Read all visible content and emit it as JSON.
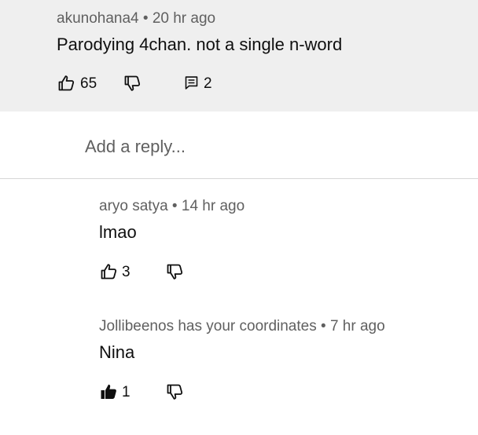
{
  "parent_comment": {
    "author": "akunohana4",
    "time": "20 hr ago",
    "text": "Parodying 4chan. not a single n-word",
    "like_count": "65",
    "reply_count": "2"
  },
  "reply_box": {
    "placeholder": "Add a reply..."
  },
  "replies": [
    {
      "author": "aryo satya",
      "time": "14 hr ago",
      "text": "lmao",
      "like_count": "3",
      "liked": false
    },
    {
      "author": "Jollibeenos has your coordinates",
      "time": "7 hr ago",
      "text": "Nina",
      "like_count": "1",
      "liked": true
    }
  ],
  "icons": {
    "like": "thumb-up-icon",
    "dislike": "thumb-down-icon",
    "replies": "comment-icon"
  },
  "colors": {
    "parent_background": "#efefef",
    "meta_text": "#606060",
    "body_text": "#0f0f0f",
    "divider": "#d6d6d6"
  }
}
